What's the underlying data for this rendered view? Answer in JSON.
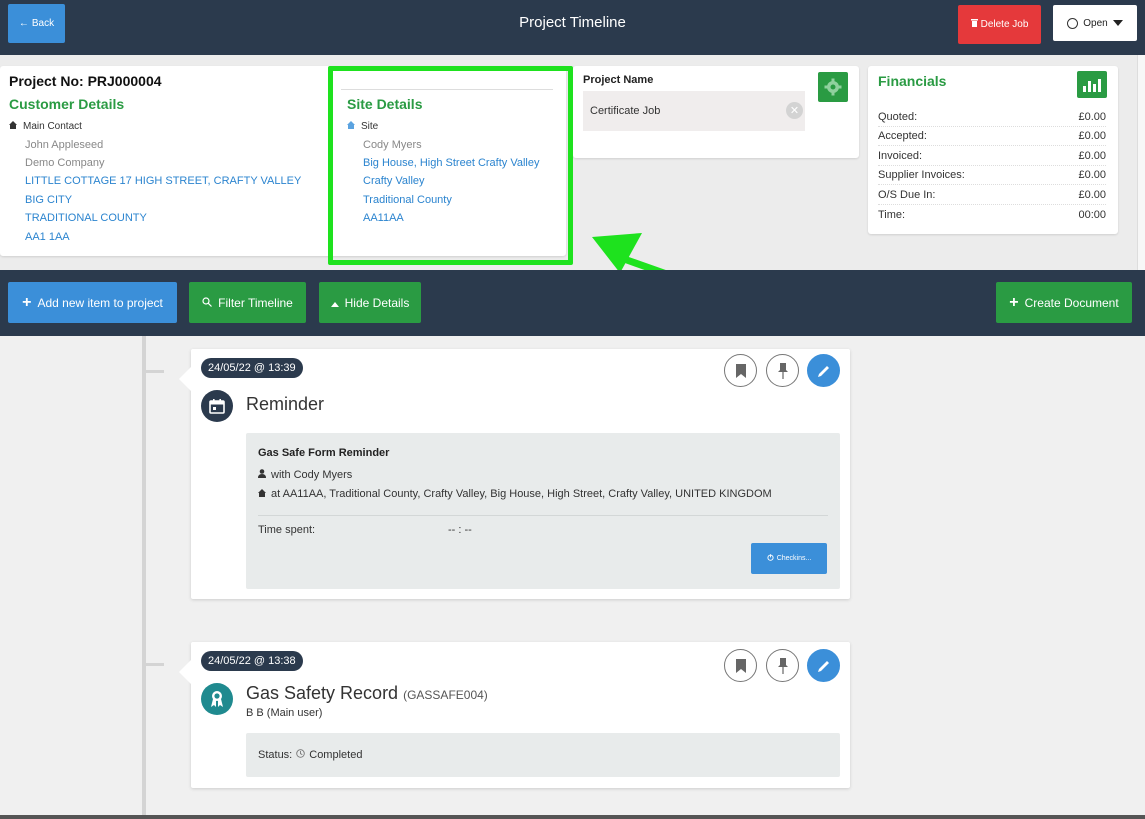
{
  "header": {
    "back_label": "Back",
    "title": "Project Timeline",
    "delete_label": "Delete Job",
    "status_label": "Open"
  },
  "project": {
    "number_label": "Project No: PRJ000004",
    "name_label": "Project Name",
    "name_value": "Certificate Job"
  },
  "customer": {
    "title": "Customer Details",
    "contact_label": "Main Contact",
    "name": "John Appleseed",
    "company": "Demo Company",
    "address_line1": "LITTLE COTTAGE 17 HIGH STREET, CRAFTY VALLEY",
    "city": "BIG CITY",
    "county": "TRADITIONAL COUNTY",
    "postcode": "AA1 1AA"
  },
  "site": {
    "title": "Site Details",
    "label": "Site",
    "name": "Cody Myers",
    "address_line1": "Big House, High Street Crafty Valley",
    "city": "Crafty Valley",
    "county": "Traditional County",
    "postcode": "AA11AA"
  },
  "financials": {
    "title": "Financials",
    "rows": [
      {
        "label": "Quoted:",
        "value": "£0.00"
      },
      {
        "label": "Accepted:",
        "value": "£0.00"
      },
      {
        "label": "Invoiced:",
        "value": "£0.00"
      },
      {
        "label": "Supplier Invoices:",
        "value": "£0.00"
      },
      {
        "label": "O/S Due In:",
        "value": "£0.00"
      },
      {
        "label": "Time:",
        "value": "00:00"
      }
    ]
  },
  "actions": {
    "add_label": "Add new item to project",
    "filter_label": "Filter Timeline",
    "hide_label": "Hide Details",
    "create_label": "Create Document"
  },
  "timeline": [
    {
      "date": "24/05/22 @ 13:39",
      "title": "Reminder",
      "box_title": "Gas Safe Form Reminder",
      "with_text": "with Cody Myers",
      "at_text": "at AA11AA, Traditional County, Crafty Valley, Big House, High Street, Crafty Valley, UNITED KINGDOM",
      "time_spent_label": "Time spent:",
      "time_spent_value": "-- : --",
      "checkin_label": "Checkins..."
    },
    {
      "date": "24/05/22 @ 13:38",
      "title": "Gas Safety Record",
      "code": "(GASSAFE004)",
      "user": "B B (Main user)",
      "status_label": "Status:",
      "status_value": "Completed"
    }
  ],
  "colors": {
    "navbar": "#2b3a4d",
    "primary_blue": "#3b8fd9",
    "green": "#2a9b43",
    "danger": "#e5393b",
    "highlight": "#1ee21e",
    "teal_icon": "#1f8a8f"
  }
}
